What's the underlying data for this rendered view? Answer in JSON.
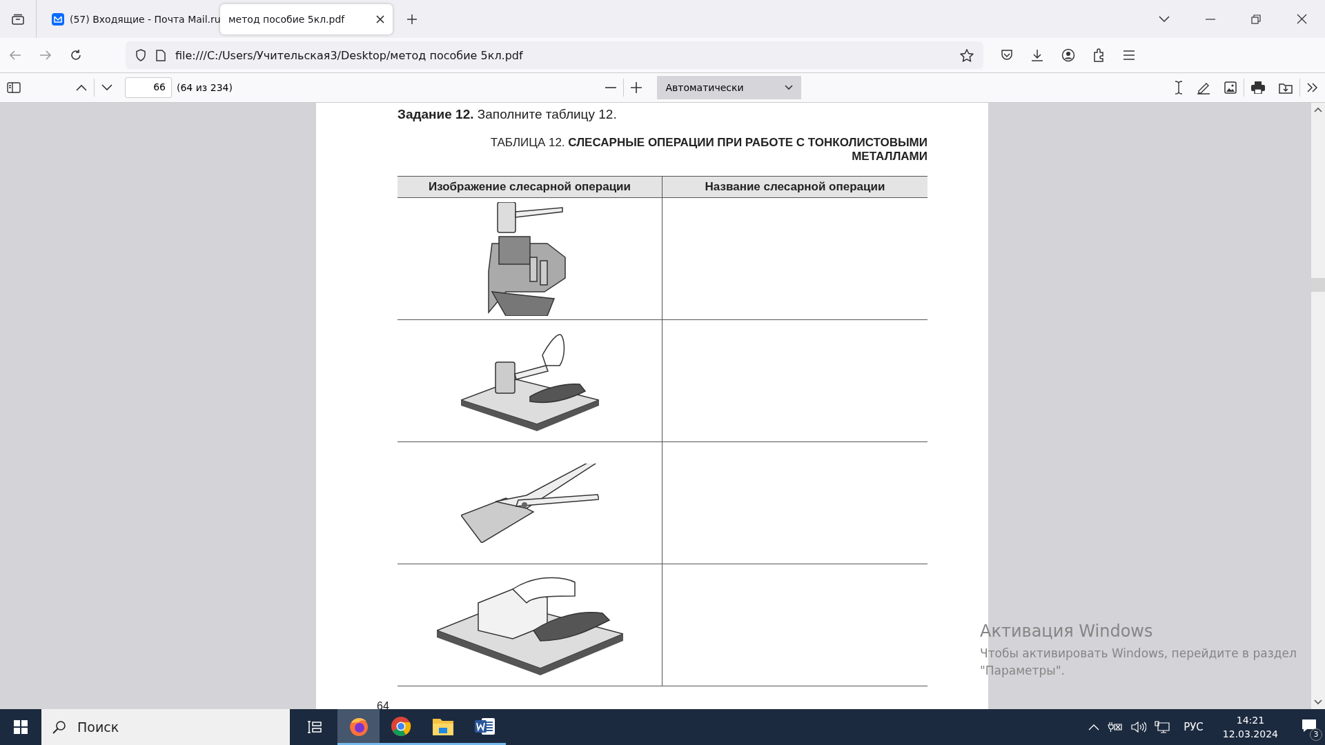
{
  "tabs": [
    {
      "kind": "mail",
      "title": "(57) Входящие - Почта Mail.ru",
      "selected": false
    },
    {
      "kind": "doc",
      "title": "метод пособие 5кл.pdf",
      "selected": true
    }
  ],
  "address_bar": {
    "url": "file:///C:/Users/Учительская3/Desktop/метод пособие 5кл.pdf"
  },
  "pdf_toolbar": {
    "page_number": "66",
    "page_count": "(64 из 234)",
    "zoom": "Автоматически"
  },
  "document": {
    "task": "**Задание 12.** Заполните таблицу 12.",
    "table_title": "ТАБЛИЦА 12.  **СЛЕСАРНЫЕ ОПЕРАЦИИ ПРИ РАБОТЕ С ТОНКОЛИСТОВЫМИ МЕТАЛЛАМИ**",
    "columns": [
      "Изображение слесарной операции",
      "Название слесарной операции"
    ],
    "rows": [
      {
        "kind": "vise"
      },
      {
        "kind": "hammer"
      },
      {
        "kind": "snips"
      },
      {
        "kind": "block"
      }
    ],
    "page_footer": "64"
  },
  "activation_notice": {
    "title": "Активация Windows",
    "text": "Чтобы активировать Windows, перейдите в раздел \"Параметры\"."
  },
  "taskbar": {
    "search_placeholder": "Поиск",
    "apps": [
      {
        "kind": "firefox",
        "selected": true
      },
      {
        "kind": "chrome",
        "selected": false
      },
      {
        "kind": "explorer",
        "selected": false
      },
      {
        "kind": "word",
        "selected": false
      }
    ],
    "language": "РУС",
    "time": "14:21",
    "date": "12.03.2024",
    "notification_count": "3"
  }
}
